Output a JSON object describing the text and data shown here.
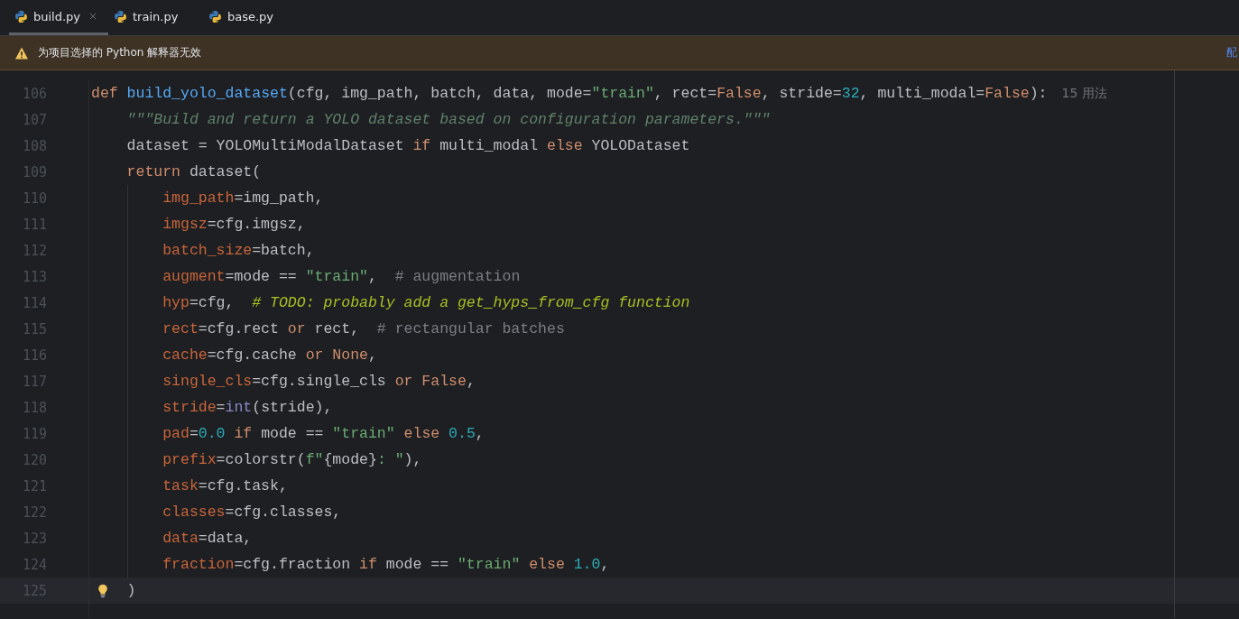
{
  "tabs": [
    {
      "label": "build.py",
      "selected": true,
      "closable": true
    },
    {
      "label": "train.py",
      "selected": false,
      "closable": false
    },
    {
      "label": "base.py",
      "selected": false,
      "closable": false
    }
  ],
  "banner": {
    "message": "为项目选择的 Python 解释器无效",
    "action": "配"
  },
  "editor": {
    "lines": [
      {
        "number": "106",
        "current": false,
        "bulb": false,
        "hint": "15 用法",
        "tokens": [
          {
            "kind": "kw",
            "text": "def "
          },
          {
            "kind": "fn",
            "text": "build_yolo_dataset"
          },
          {
            "kind": "plain",
            "text": "(cfg, img_path, batch, data, mode="
          },
          {
            "kind": "str",
            "text": "\"train\""
          },
          {
            "kind": "plain",
            "text": ", rect="
          },
          {
            "kind": "kw",
            "text": "False"
          },
          {
            "kind": "plain",
            "text": ", stride="
          },
          {
            "kind": "num",
            "text": "32"
          },
          {
            "kind": "plain",
            "text": ", multi_modal="
          },
          {
            "kind": "kw",
            "text": "False"
          },
          {
            "kind": "plain",
            "text": "):"
          }
        ],
        "children": [
          {
            "number": "107",
            "current": false,
            "bulb": false,
            "tokens": [
              {
                "kind": "doc",
                "text": "\"\"\"Build and return a YOLO dataset based on configuration parameters.\"\"\""
              }
            ]
          },
          {
            "number": "108",
            "current": false,
            "bulb": false,
            "tokens": [
              {
                "kind": "plain",
                "text": "dataset = YOLOMultiModalDataset"
              },
              {
                "kind": "kw",
                "text": " if "
              },
              {
                "kind": "plain",
                "text": "multi_modal"
              },
              {
                "kind": "kw",
                "text": " else "
              },
              {
                "kind": "plain",
                "text": "YOLODataset"
              }
            ]
          },
          {
            "number": "109",
            "current": false,
            "bulb": false,
            "tokens": [
              {
                "kind": "kw",
                "text": "return"
              },
              {
                "kind": "plain",
                "text": " dataset("
              }
            ],
            "children": [
              {
                "number": "110",
                "current": false,
                "bulb": false,
                "tokens": [
                  {
                    "kind": "param",
                    "text": "img_path"
                  },
                  {
                    "kind": "plain",
                    "text": "=img_path,"
                  }
                ]
              },
              {
                "number": "111",
                "current": false,
                "bulb": false,
                "tokens": [
                  {
                    "kind": "param",
                    "text": "imgsz"
                  },
                  {
                    "kind": "plain",
                    "text": "=cfg.imgsz,"
                  }
                ]
              },
              {
                "number": "112",
                "current": false,
                "bulb": false,
                "tokens": [
                  {
                    "kind": "param",
                    "text": "batch_size"
                  },
                  {
                    "kind": "plain",
                    "text": "=batch,"
                  }
                ]
              },
              {
                "number": "113",
                "current": false,
                "bulb": false,
                "tokens": [
                  {
                    "kind": "param",
                    "text": "augment"
                  },
                  {
                    "kind": "plain",
                    "text": "=mode == "
                  },
                  {
                    "kind": "str",
                    "text": "\"train\""
                  },
                  {
                    "kind": "plain",
                    "text": ",  "
                  },
                  {
                    "kind": "comment",
                    "text": "# augmentation"
                  }
                ]
              },
              {
                "number": "114",
                "current": false,
                "bulb": false,
                "tokens": [
                  {
                    "kind": "param",
                    "text": "hyp"
                  },
                  {
                    "kind": "plain",
                    "text": "=cfg,  "
                  },
                  {
                    "kind": "todo",
                    "text": "# TODO: probably add a get_hyps_from_cfg function"
                  }
                ]
              },
              {
                "number": "115",
                "current": false,
                "bulb": false,
                "tokens": [
                  {
                    "kind": "param",
                    "text": "rect"
                  },
                  {
                    "kind": "plain",
                    "text": "=cfg.rect"
                  },
                  {
                    "kind": "kw",
                    "text": " or "
                  },
                  {
                    "kind": "plain",
                    "text": "rect,  "
                  },
                  {
                    "kind": "comment",
                    "text": "# rectangular batches"
                  }
                ]
              },
              {
                "number": "116",
                "current": false,
                "bulb": false,
                "tokens": [
                  {
                    "kind": "param",
                    "text": "cache"
                  },
                  {
                    "kind": "plain",
                    "text": "=cfg.cache"
                  },
                  {
                    "kind": "kw",
                    "text": " or None"
                  },
                  {
                    "kind": "plain",
                    "text": ","
                  }
                ]
              },
              {
                "number": "117",
                "current": false,
                "bulb": false,
                "tokens": [
                  {
                    "kind": "param",
                    "text": "single_cls"
                  },
                  {
                    "kind": "plain",
                    "text": "=cfg.single_cls"
                  },
                  {
                    "kind": "kw",
                    "text": " or False"
                  },
                  {
                    "kind": "plain",
                    "text": ","
                  }
                ]
              },
              {
                "number": "118",
                "current": false,
                "bulb": false,
                "tokens": [
                  {
                    "kind": "param",
                    "text": "stride"
                  },
                  {
                    "kind": "plain",
                    "text": "="
                  },
                  {
                    "kind": "builtin",
                    "text": "int"
                  },
                  {
                    "kind": "plain",
                    "text": "(stride),"
                  }
                ]
              },
              {
                "number": "119",
                "current": false,
                "bulb": false,
                "tokens": [
                  {
                    "kind": "param",
                    "text": "pad"
                  },
                  {
                    "kind": "plain",
                    "text": "="
                  },
                  {
                    "kind": "num",
                    "text": "0.0"
                  },
                  {
                    "kind": "kw",
                    "text": " if "
                  },
                  {
                    "kind": "plain",
                    "text": "mode == "
                  },
                  {
                    "kind": "str",
                    "text": "\"train\""
                  },
                  {
                    "kind": "kw",
                    "text": " else "
                  },
                  {
                    "kind": "num",
                    "text": "0.5"
                  },
                  {
                    "kind": "plain",
                    "text": ","
                  }
                ]
              },
              {
                "number": "120",
                "current": false,
                "bulb": false,
                "tokens": [
                  {
                    "kind": "param",
                    "text": "prefix"
                  },
                  {
                    "kind": "plain",
                    "text": "=colorstr("
                  },
                  {
                    "kind": "str",
                    "text": "f\""
                  },
                  {
                    "kind": "plain",
                    "text": "{mode}"
                  },
                  {
                    "kind": "str",
                    "text": ": \""
                  },
                  {
                    "kind": "plain",
                    "text": "),"
                  }
                ]
              },
              {
                "number": "121",
                "current": false,
                "bulb": false,
                "tokens": [
                  {
                    "kind": "param",
                    "text": "task"
                  },
                  {
                    "kind": "plain",
                    "text": "=cfg.task,"
                  }
                ]
              },
              {
                "number": "122",
                "current": false,
                "bulb": false,
                "tokens": [
                  {
                    "kind": "param",
                    "text": "classes"
                  },
                  {
                    "kind": "plain",
                    "text": "=cfg.classes,"
                  }
                ]
              },
              {
                "number": "123",
                "current": false,
                "bulb": false,
                "tokens": [
                  {
                    "kind": "param",
                    "text": "data"
                  },
                  {
                    "kind": "plain",
                    "text": "=data,"
                  }
                ]
              },
              {
                "number": "124",
                "current": false,
                "bulb": false,
                "tokens": [
                  {
                    "kind": "param",
                    "text": "fraction"
                  },
                  {
                    "kind": "plain",
                    "text": "=cfg.fraction"
                  },
                  {
                    "kind": "kw",
                    "text": " if "
                  },
                  {
                    "kind": "plain",
                    "text": "mode == "
                  },
                  {
                    "kind": "str",
                    "text": "\"train\""
                  },
                  {
                    "kind": "kw",
                    "text": " else "
                  },
                  {
                    "kind": "num",
                    "text": "1.0"
                  },
                  {
                    "kind": "plain",
                    "text": ","
                  }
                ]
              }
            ]
          },
          {
            "number": "125",
            "current": true,
            "bulb": true,
            "tokens": [
              {
                "kind": "plain",
                "text": ")"
              }
            ]
          }
        ]
      }
    ]
  }
}
